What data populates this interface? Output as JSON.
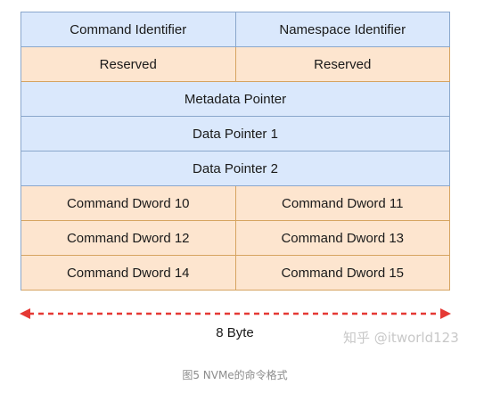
{
  "fields": {
    "command_identifier": "Command Identifier",
    "namespace_identifier": "Namespace Identifier",
    "reserved_left": "Reserved",
    "reserved_right": "Reserved",
    "metadata_pointer": "Metadata Pointer",
    "data_pointer_1": "Data Pointer 1",
    "data_pointer_2": "Data Pointer 2",
    "dword_10": "Command Dword 10",
    "dword_11": "Command Dword 11",
    "dword_12": "Command Dword 12",
    "dword_13": "Command Dword 13",
    "dword_14": "Command Dword 14",
    "dword_15": "Command Dword 15"
  },
  "width_label": "8 Byte",
  "watermark": "知乎 @itworld123",
  "caption": "图5 NVMe的命令格式",
  "colors": {
    "blue_fill": "#dae8fc",
    "orange_fill": "#fde5cf",
    "arrow": "#e53935"
  }
}
